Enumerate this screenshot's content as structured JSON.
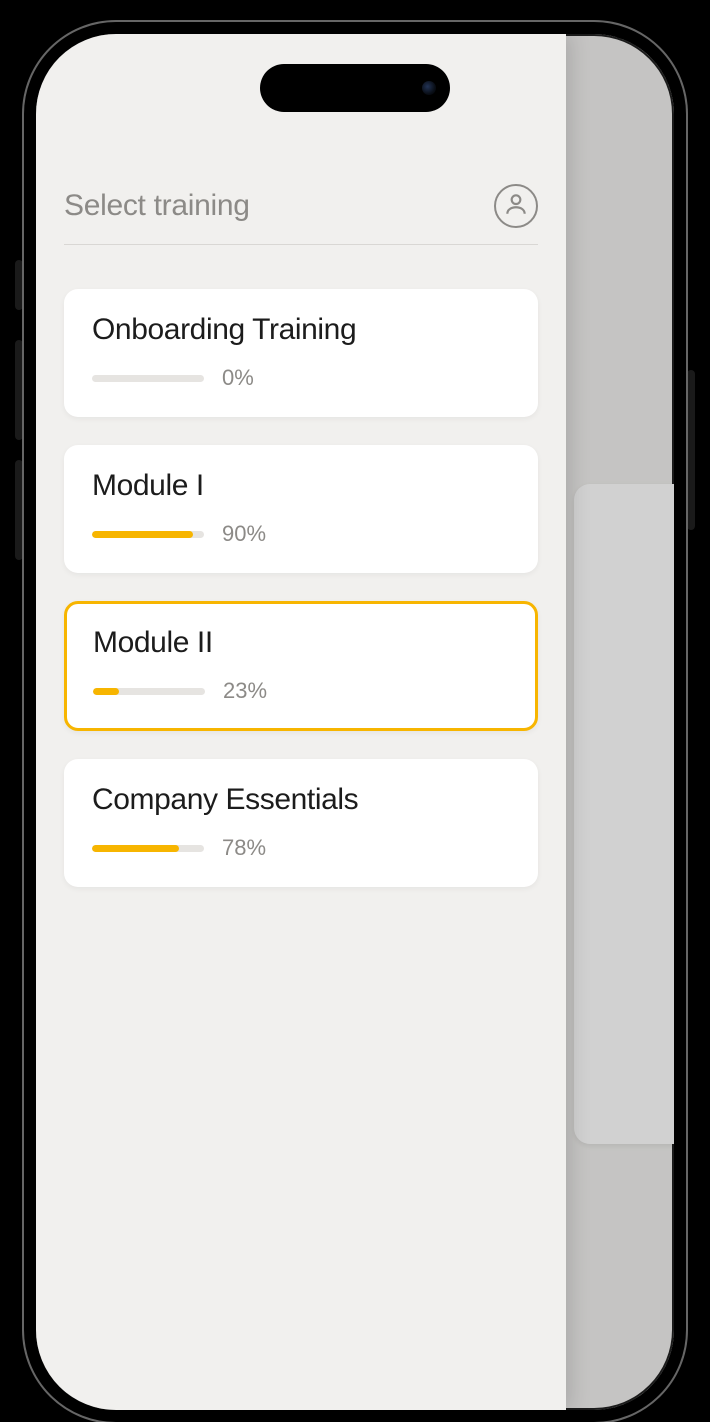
{
  "header": {
    "title": "Select training"
  },
  "colors": {
    "accent": "#f7b500",
    "card_bg": "#ffffff",
    "page_bg": "#f1f0ee",
    "muted": "#8c8a87"
  },
  "trainings": [
    {
      "title": "Onboarding Training",
      "progress": 0,
      "progress_label": "0%",
      "selected": false
    },
    {
      "title": "Module I",
      "progress": 90,
      "progress_label": "90%",
      "selected": false
    },
    {
      "title": "Module II",
      "progress": 23,
      "progress_label": "23%",
      "selected": true
    },
    {
      "title": "Company Essentials",
      "progress": 78,
      "progress_label": "78%",
      "selected": false
    }
  ]
}
